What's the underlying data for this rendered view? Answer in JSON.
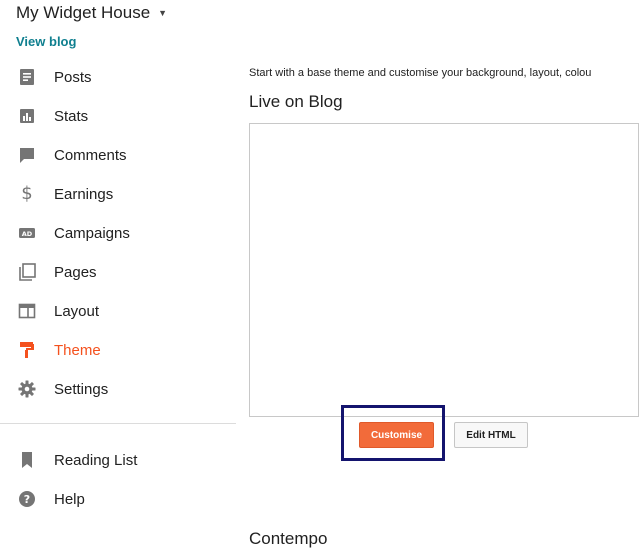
{
  "sidebar": {
    "blog_title": "My Widget House",
    "view_blog": "View blog",
    "items": [
      {
        "label": "Posts",
        "icon": "posts-icon"
      },
      {
        "label": "Stats",
        "icon": "stats-icon"
      },
      {
        "label": "Comments",
        "icon": "comments-icon"
      },
      {
        "label": "Earnings",
        "icon": "dollar-icon"
      },
      {
        "label": "Campaigns",
        "icon": "ad-icon"
      },
      {
        "label": "Pages",
        "icon": "pages-icon"
      },
      {
        "label": "Layout",
        "icon": "layout-icon"
      },
      {
        "label": "Theme",
        "icon": "theme-icon",
        "active": true
      },
      {
        "label": "Settings",
        "icon": "gear-icon"
      }
    ],
    "secondary": [
      {
        "label": "Reading List",
        "icon": "bookmark-icon"
      },
      {
        "label": "Help",
        "icon": "help-icon"
      }
    ]
  },
  "main": {
    "description": "Start with a base theme and customise your background, layout, colou",
    "live_title": "Live on Blog",
    "customise_label": "Customise",
    "edit_html_label": "Edit HTML",
    "theme_name": "Contempo"
  },
  "colors": {
    "accent": "#f4511e",
    "customise_button": "#f26b3a",
    "icon_gray": "#757575",
    "link": "#0f7f8f",
    "highlight_border": "#14146e"
  }
}
